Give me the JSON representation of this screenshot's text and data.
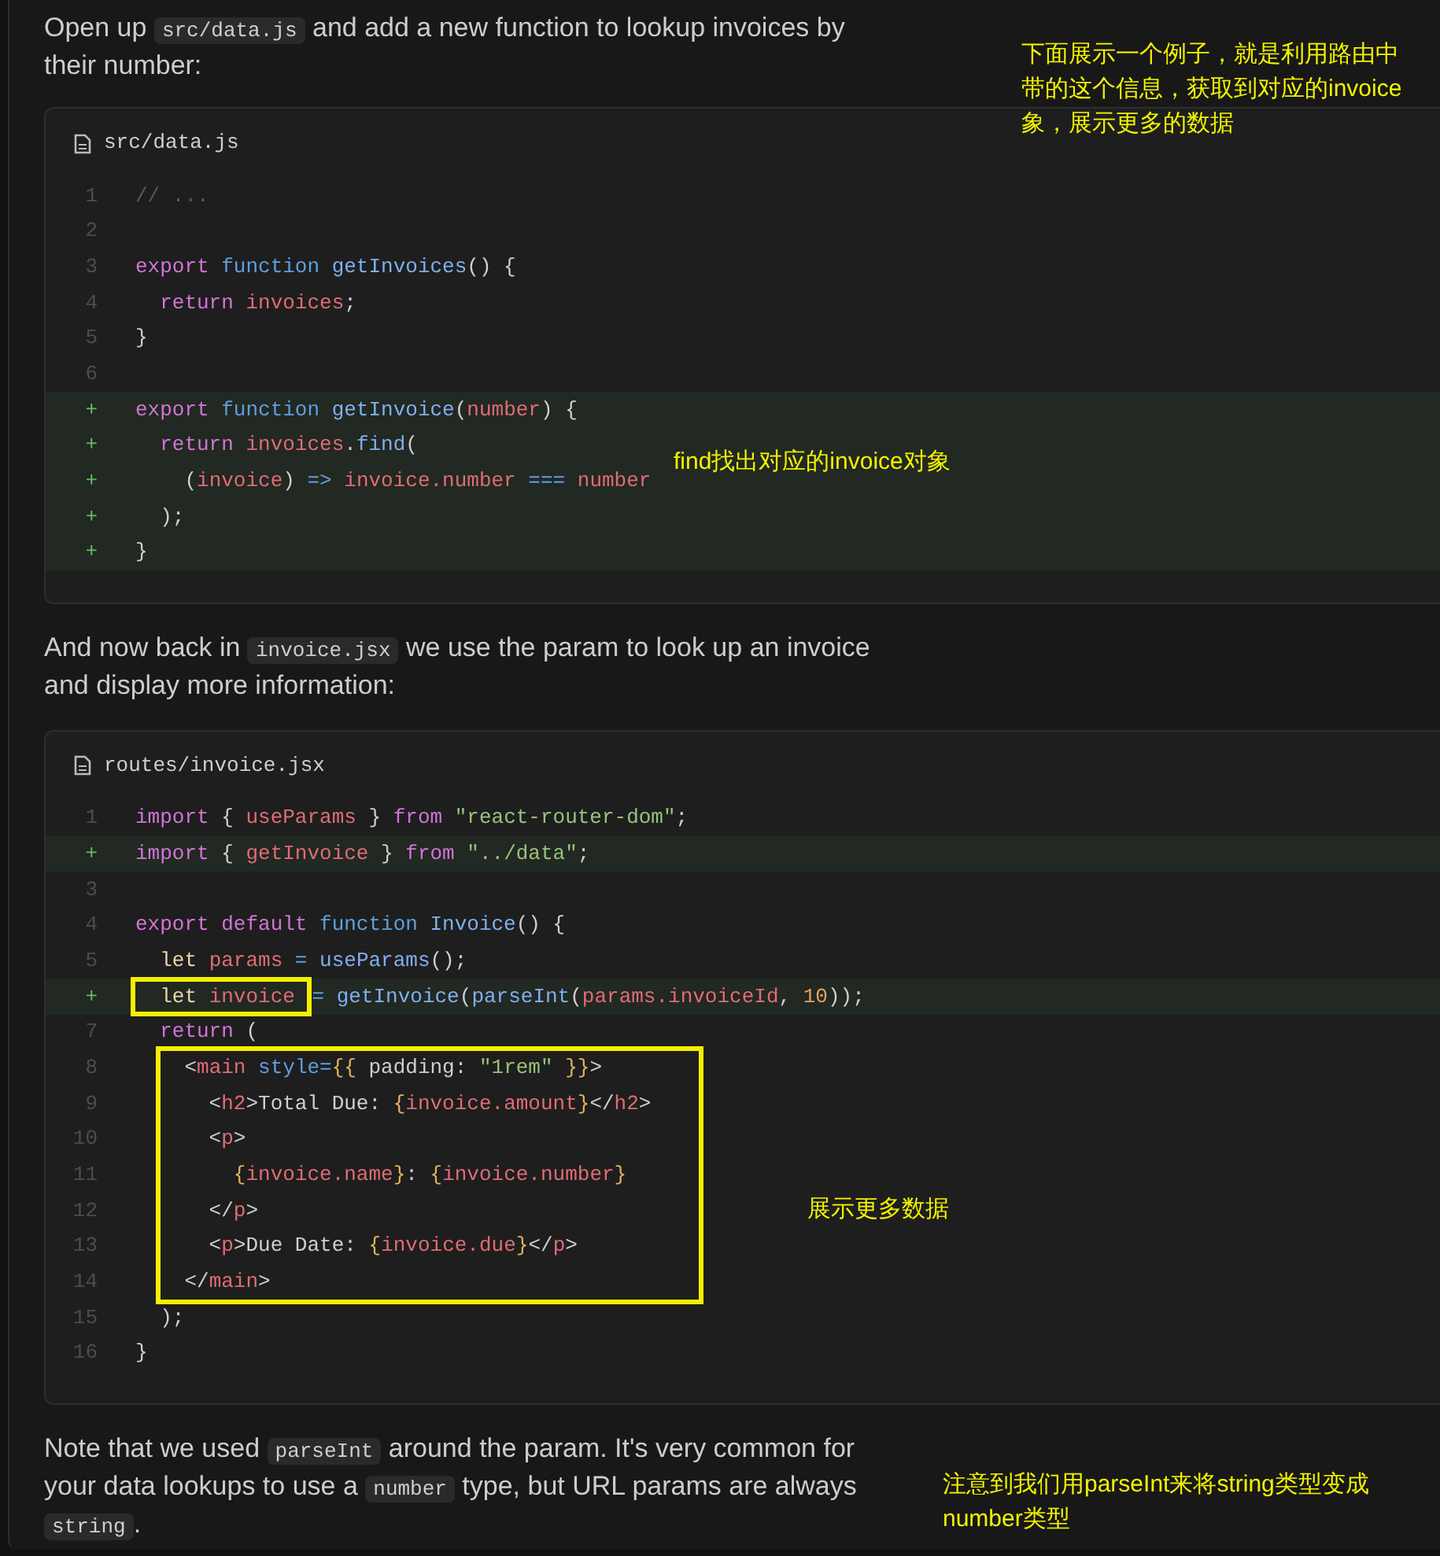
{
  "content": [
    {
      "kind": "paragraph",
      "segments": [
        {
          "kind": "text",
          "text": "Open up "
        },
        {
          "kind": "code",
          "text": "src/data.js"
        },
        {
          "kind": "text",
          "text": " and add a new function to lookup invoices by their number:"
        }
      ]
    },
    {
      "kind": "code",
      "filename": "src/data.js",
      "lines": [
        {
          "kind": "line",
          "gutter": "1",
          "added": false,
          "tokens": [
            {
              "kind": "comment",
              "text": "// ..."
            }
          ]
        },
        {
          "kind": "line",
          "gutter": "2",
          "added": false
        },
        {
          "kind": "line",
          "gutter": "3",
          "added": false,
          "tokens": [
            {
              "kind": "keyword",
              "text": "export"
            },
            {
              "kind": "storage",
              "text": " function"
            },
            {
              "kind": "func",
              "text": " getInvoices"
            },
            {
              "kind": "punct",
              "text": "() {"
            }
          ]
        },
        {
          "kind": "line",
          "gutter": "4",
          "added": false,
          "tokens": [
            {
              "kind": "keyword",
              "text": "  return"
            },
            {
              "kind": "variable",
              "text": " invoices"
            },
            {
              "kind": "punct",
              "text": ";"
            }
          ]
        },
        {
          "kind": "line",
          "gutter": "5",
          "added": false,
          "tokens": [
            {
              "kind": "punct",
              "text": "}"
            }
          ]
        },
        {
          "kind": "line",
          "gutter": "6",
          "added": false
        },
        {
          "kind": "line",
          "gutter": "+",
          "added": true,
          "tokens": [
            {
              "kind": "keyword",
              "text": "export"
            },
            {
              "kind": "storage",
              "text": " function"
            },
            {
              "kind": "func",
              "text": " getInvoice"
            },
            {
              "kind": "punct",
              "text": "("
            },
            {
              "kind": "variable",
              "text": "number"
            },
            {
              "kind": "punct",
              "text": ") {"
            }
          ]
        },
        {
          "kind": "line",
          "gutter": "+",
          "added": true,
          "tokens": [
            {
              "kind": "keyword",
              "text": "  return"
            },
            {
              "kind": "variable",
              "text": " invoices"
            },
            {
              "kind": "punct",
              "text": "."
            },
            {
              "kind": "func",
              "text": "find"
            },
            {
              "kind": "punct",
              "text": "("
            }
          ]
        },
        {
          "kind": "line",
          "gutter": "+",
          "added": true,
          "tokens": [
            {
              "kind": "punct",
              "text": "    ("
            },
            {
              "kind": "variable",
              "text": "invoice"
            },
            {
              "kind": "punct",
              "text": ") "
            },
            {
              "kind": "storage",
              "text": "=>"
            },
            {
              "kind": "variable",
              "text": " invoice.number"
            },
            {
              "kind": "storage",
              "text": " ==="
            },
            {
              "kind": "variable",
              "text": " number"
            }
          ]
        },
        {
          "kind": "line",
          "gutter": "+",
          "added": true,
          "tokens": [
            {
              "kind": "punct",
              "text": "  );"
            }
          ]
        },
        {
          "kind": "line",
          "gutter": "+",
          "added": true,
          "tokens": [
            {
              "kind": "punct",
              "text": "}"
            }
          ]
        }
      ]
    },
    {
      "kind": "paragraph",
      "segments": [
        {
          "kind": "text",
          "text": "And now back in "
        },
        {
          "kind": "code",
          "text": "invoice.jsx"
        },
        {
          "kind": "text",
          "text": " we use the param to look up an invoice and display more information:"
        }
      ]
    },
    {
      "kind": "code",
      "filename": "routes/invoice.jsx",
      "lines": [
        {
          "kind": "line",
          "gutter": "1",
          "added": false,
          "tokens": [
            {
              "kind": "keyword",
              "text": "import"
            },
            {
              "kind": "punct",
              "text": " { "
            },
            {
              "kind": "variable",
              "text": "useParams"
            },
            {
              "kind": "punct",
              "text": " } "
            },
            {
              "kind": "keyword",
              "text": "from"
            },
            {
              "kind": "string",
              "text": " \"react-router-dom\""
            },
            {
              "kind": "punct",
              "text": ";"
            }
          ]
        },
        {
          "kind": "line",
          "gutter": "+",
          "added": true,
          "tokens": [
            {
              "kind": "keyword",
              "text": "import"
            },
            {
              "kind": "punct",
              "text": " { "
            },
            {
              "kind": "variable",
              "text": "getInvoice"
            },
            {
              "kind": "punct",
              "text": " } "
            },
            {
              "kind": "keyword",
              "text": "from"
            },
            {
              "kind": "string",
              "text": " \"../data\""
            },
            {
              "kind": "punct",
              "text": ";"
            }
          ]
        },
        {
          "kind": "line",
          "gutter": "3",
          "added": false
        },
        {
          "kind": "line",
          "gutter": "4",
          "added": false,
          "tokens": [
            {
              "kind": "keyword",
              "text": "export default"
            },
            {
              "kind": "storage",
              "text": " function"
            },
            {
              "kind": "func",
              "text": " Invoice"
            },
            {
              "kind": "punct",
              "text": "() {"
            }
          ]
        },
        {
          "kind": "line",
          "gutter": "5",
          "added": false,
          "tokens": [
            {
              "kind": "decl",
              "text": "  let"
            },
            {
              "kind": "variable",
              "text": " params"
            },
            {
              "kind": "storage",
              "text": " ="
            },
            {
              "kind": "func",
              "text": " useParams"
            },
            {
              "kind": "punct",
              "text": "();"
            }
          ]
        },
        {
          "kind": "line",
          "gutter": "+",
          "added": true,
          "tokens": [
            {
              "kind": "highlight",
              "tokens": [
                {
                  "kind": "decl",
                  "text": "  let"
                },
                {
                  "kind": "variable",
                  "text": " invoice "
                }
              ]
            },
            {
              "kind": "storage",
              "text": "="
            },
            {
              "kind": "func",
              "text": " getInvoice"
            },
            {
              "kind": "punct",
              "text": "("
            },
            {
              "kind": "func",
              "text": "parseInt"
            },
            {
              "kind": "punct",
              "text": "("
            },
            {
              "kind": "variable",
              "text": "params.invoiceId"
            },
            {
              "kind": "punct",
              "text": ", "
            },
            {
              "kind": "number",
              "text": "10"
            },
            {
              "kind": "punct",
              "text": "));"
            }
          ]
        },
        {
          "kind": "line",
          "gutter": "7",
          "added": false,
          "tokens": [
            {
              "kind": "keyword",
              "text": "  return"
            },
            {
              "kind": "punct",
              "text": " ("
            }
          ]
        },
        {
          "kind": "highlight",
          "lines": [
            {
              "kind": "line",
              "gutter": "8",
              "added": false,
              "tokens": [
                {
                  "kind": "punct",
                  "text": "    <"
                },
                {
                  "kind": "tag",
                  "text": "main"
                },
                {
                  "kind": "storage",
                  "text": " style="
                },
                {
                  "kind": "brace",
                  "text": "{{"
                },
                {
                  "kind": "punct",
                  "text": " padding: "
                },
                {
                  "kind": "string",
                  "text": "\"1rem\""
                },
                {
                  "kind": "brace",
                  "text": " }}"
                },
                {
                  "kind": "punct",
                  "text": ">"
                }
              ]
            },
            {
              "kind": "line",
              "gutter": "9",
              "added": false,
              "tokens": [
                {
                  "kind": "punct",
                  "text": "      <"
                },
                {
                  "kind": "tag",
                  "text": "h2"
                },
                {
                  "kind": "punct",
                  "text": ">Total Due: "
                },
                {
                  "kind": "brace",
                  "text": "{"
                },
                {
                  "kind": "variable",
                  "text": "invoice.amount"
                },
                {
                  "kind": "brace",
                  "text": "}"
                },
                {
                  "kind": "punct",
                  "text": "</"
                },
                {
                  "kind": "tag",
                  "text": "h2"
                },
                {
                  "kind": "punct",
                  "text": ">"
                }
              ]
            },
            {
              "kind": "line",
              "gutter": "10",
              "added": false,
              "tokens": [
                {
                  "kind": "punct",
                  "text": "      <"
                },
                {
                  "kind": "tag",
                  "text": "p"
                },
                {
                  "kind": "punct",
                  "text": ">"
                }
              ]
            },
            {
              "kind": "line",
              "gutter": "11",
              "added": false,
              "tokens": [
                {
                  "kind": "brace",
                  "text": "        {"
                },
                {
                  "kind": "variable",
                  "text": "invoice.name"
                },
                {
                  "kind": "brace",
                  "text": "}"
                },
                {
                  "kind": "punct",
                  "text": ": "
                },
                {
                  "kind": "brace",
                  "text": "{"
                },
                {
                  "kind": "variable",
                  "text": "invoice.number"
                },
                {
                  "kind": "brace",
                  "text": "}"
                }
              ]
            },
            {
              "kind": "line",
              "gutter": "12",
              "added": false,
              "tokens": [
                {
                  "kind": "punct",
                  "text": "      </"
                },
                {
                  "kind": "tag",
                  "text": "p"
                },
                {
                  "kind": "punct",
                  "text": ">"
                }
              ]
            },
            {
              "kind": "line",
              "gutter": "13",
              "added": false,
              "tokens": [
                {
                  "kind": "punct",
                  "text": "      <"
                },
                {
                  "kind": "tag",
                  "text": "p"
                },
                {
                  "kind": "punct",
                  "text": ">Due Date: "
                },
                {
                  "kind": "brace",
                  "text": "{"
                },
                {
                  "kind": "variable",
                  "text": "invoice.due"
                },
                {
                  "kind": "brace",
                  "text": "}"
                },
                {
                  "kind": "punct",
                  "text": "</"
                },
                {
                  "kind": "tag",
                  "text": "p"
                },
                {
                  "kind": "punct",
                  "text": ">"
                }
              ]
            },
            {
              "kind": "line",
              "gutter": "14",
              "added": false,
              "tokens": [
                {
                  "kind": "punct",
                  "text": "    </"
                },
                {
                  "kind": "tag",
                  "text": "main"
                },
                {
                  "kind": "punct",
                  "text": ">"
                }
              ]
            }
          ]
        },
        {
          "kind": "line",
          "gutter": "15",
          "added": false,
          "tokens": [
            {
              "kind": "punct",
              "text": "  );"
            }
          ]
        },
        {
          "kind": "line",
          "gutter": "16",
          "added": false,
          "tokens": [
            {
              "kind": "punct",
              "text": "}"
            }
          ]
        }
      ]
    },
    {
      "kind": "paragraph",
      "segments": [
        {
          "kind": "text",
          "text": "Note that we used "
        },
        {
          "kind": "code",
          "text": "parseInt"
        },
        {
          "kind": "text",
          "text": " around the param. It's very common for your data lookups to use a "
        },
        {
          "kind": "code",
          "text": "number"
        },
        {
          "kind": "text",
          "text": " type, but URL params are always "
        },
        {
          "kind": "code",
          "text": "string"
        },
        {
          "kind": "text",
          "text": "."
        }
      ]
    }
  ],
  "annotations": [
    {
      "lines": [
        "下面展示一个例子，就是利用路由中",
        "带的这个信息，获取到对应的invoice",
        "象，展示更多的数据"
      ]
    },
    {
      "lines": [
        "find找出对应的invoice对象"
      ]
    },
    {
      "lines": [
        "展示更多数据"
      ]
    },
    {
      "lines": [
        "注意到我们用parseInt来将string类型变成",
        "number类型"
      ]
    }
  ]
}
